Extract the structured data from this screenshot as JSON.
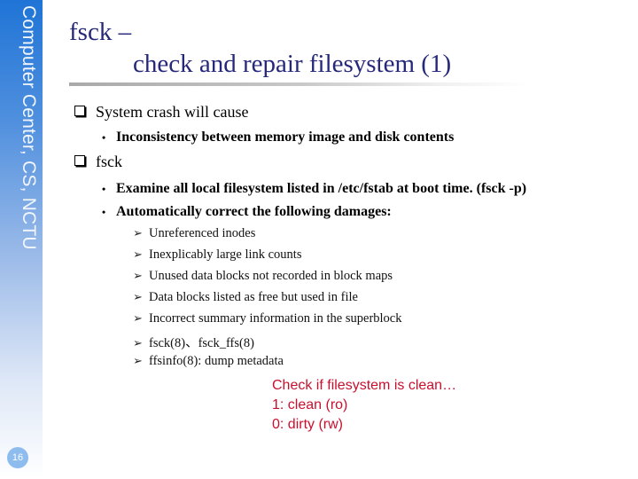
{
  "sidebar": {
    "label": "Computer Center, CS, NCTU",
    "page_number": "16"
  },
  "title": {
    "line1": "fsck –",
    "line2": "check and repair filesystem (1)"
  },
  "sections": [
    {
      "heading": "System crash will cause",
      "bullets": [
        {
          "text": "Inconsistency between memory image and disk contents"
        }
      ]
    },
    {
      "heading": "fsck",
      "bullets": [
        {
          "text": "Examine all local filesystem listed in /etc/fstab at boot time. (fsck -p)"
        },
        {
          "text": "Automatically correct the following damages:"
        }
      ],
      "sub_items": [
        "Unreferenced inodes",
        "Inexplicably large link counts",
        "Unused data blocks not recorded in block maps",
        "Data blocks listed as free but used in file",
        "Incorrect summary information in the superblock",
        "fsck(8)、fsck_ffs(8)",
        "ffsinfo(8): dump metadata"
      ]
    }
  ],
  "note": {
    "lines": [
      "Check if filesystem is clean…",
      "1: clean (ro)",
      "0: dirty (rw)"
    ],
    "color": "#c8102e"
  },
  "colors": {
    "title": "#26287a",
    "sidebar_top": "#1f74d6"
  }
}
